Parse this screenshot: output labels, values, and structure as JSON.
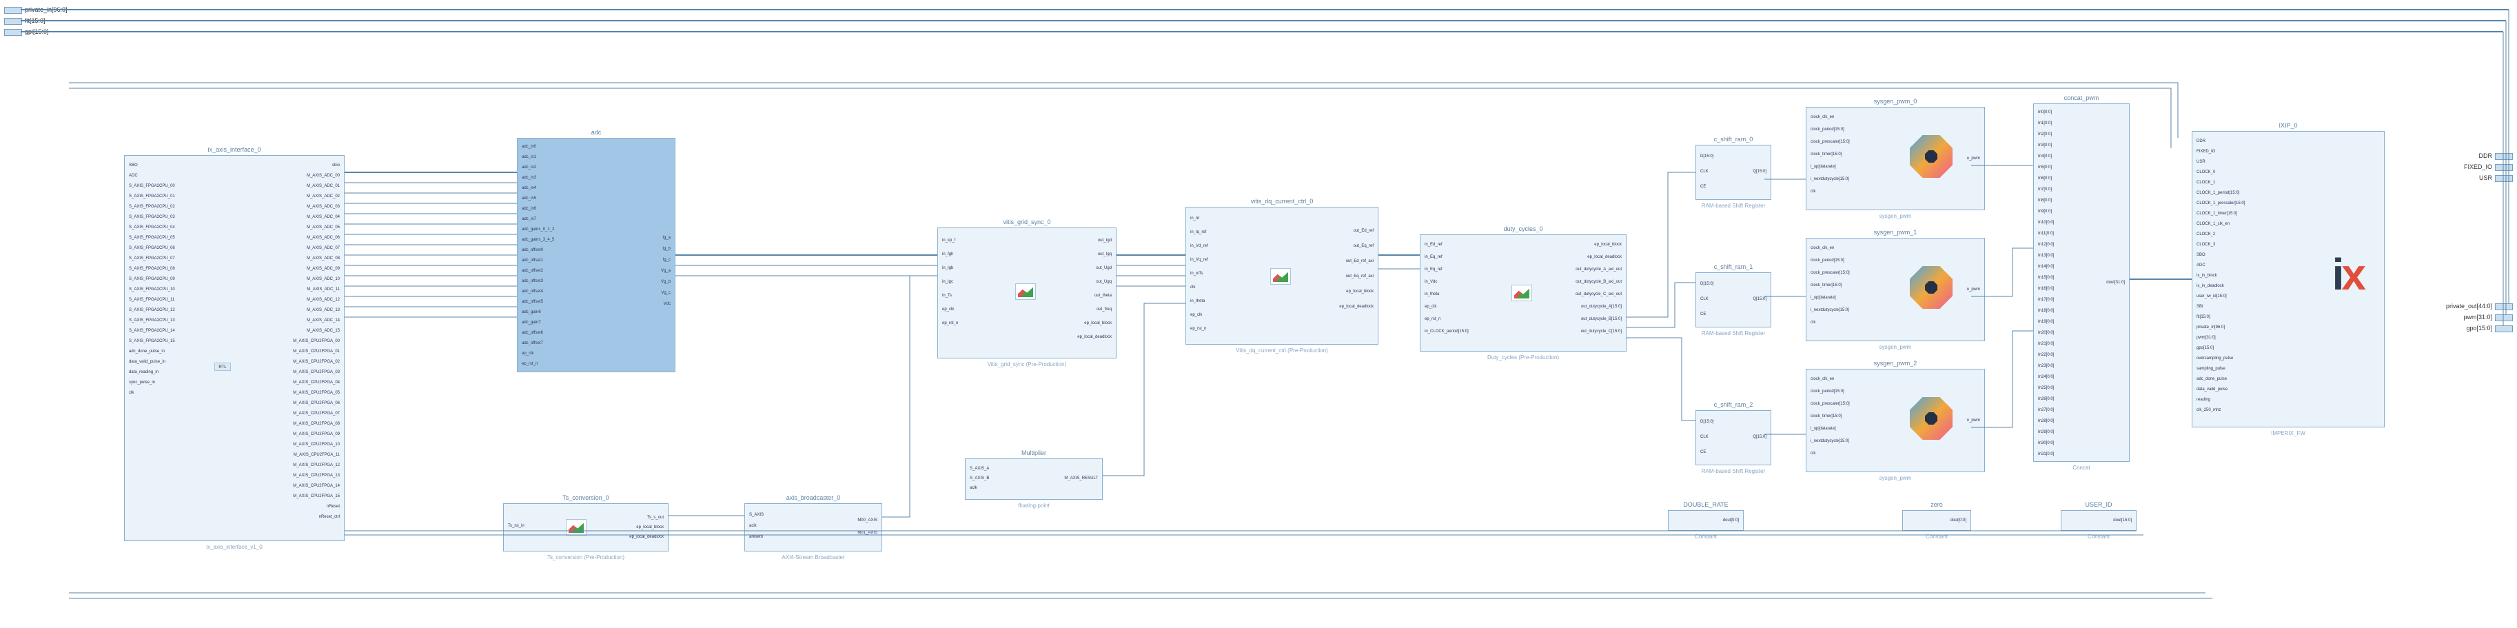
{
  "external_inputs": [
    {
      "label": "private_in[96:0]"
    },
    {
      "label": "fit[15:0]"
    },
    {
      "label": "gpi[15:0]"
    }
  ],
  "external_outputs_top": [
    {
      "label": "DDR"
    },
    {
      "label": "FIXED_IO"
    },
    {
      "label": "USR"
    }
  ],
  "external_outputs_mid": [
    {
      "label": "private_out[44:0]"
    },
    {
      "label": "pwm[31:0]"
    },
    {
      "label": "gpo[15:0]"
    }
  ],
  "ix_axis_interface": {
    "title": "ix_axis_interface_0",
    "subtitle": "ix_axis_interface_v1_0",
    "left_ports": [
      "SBO",
      "ADC",
      "S_AXIS_FPGA2CPU_00",
      "S_AXIS_FPGA2CPU_01",
      "S_AXIS_FPGA2CPU_02",
      "S_AXIS_FPGA2CPU_03",
      "S_AXIS_FPGA2CPU_04",
      "S_AXIS_FPGA2CPU_05",
      "S_AXIS_FPGA2CPU_06",
      "S_AXIS_FPGA2CPU_07",
      "S_AXIS_FPGA2CPU_08",
      "S_AXIS_FPGA2CPU_09",
      "S_AXIS_FPGA2CPU_10",
      "S_AXIS_FPGA2CPU_11",
      "S_AXIS_FPGA2CPU_12",
      "S_AXIS_FPGA2CPU_13",
      "S_AXIS_FPGA2CPU_14",
      "S_AXIS_FPGA2CPU_15",
      "adc_done_pulse_in",
      "data_valid_pulse_in",
      "data_reading_in",
      "sync_pulse_in",
      "clk"
    ],
    "right_ports": [
      "sbio",
      "M_AXIS_ADC_00",
      "M_AXIS_ADC_01",
      "M_AXIS_ADC_02",
      "M_AXIS_ADC_03",
      "M_AXIS_ADC_04",
      "M_AXIS_ADC_05",
      "M_AXIS_ADC_06",
      "M_AXIS_ADC_07",
      "M_AXIS_ADC_08",
      "M_AXIS_ADC_09",
      "M_AXIS_ADC_10",
      "M_AXIS_ADC_11",
      "M_AXIS_ADC_12",
      "M_AXIS_ADC_13",
      "M_AXIS_ADC_14",
      "M_AXIS_ADC_15",
      "M_AXIS_CPU2FPGA_00",
      "M_AXIS_CPU2FPGA_01",
      "M_AXIS_CPU2FPGA_02",
      "M_AXIS_CPU2FPGA_03",
      "M_AXIS_CPU2FPGA_04",
      "M_AXIS_CPU2FPGA_05",
      "M_AXIS_CPU2FPGA_06",
      "M_AXIS_CPU2FPGA_07",
      "M_AXIS_CPU2FPGA_08",
      "M_AXIS_CPU2FPGA_09",
      "M_AXIS_CPU2FPGA_10",
      "M_AXIS_CPU2FPGA_11",
      "M_AXIS_CPU2FPGA_12",
      "M_AXIS_CPU2FPGA_13",
      "M_AXIS_CPU2FPGA_14",
      "M_AXIS_CPU2FPGA_15",
      "nReset",
      "nReset_ctrl"
    ]
  },
  "adc": {
    "title": "adc",
    "left_ports": [
      "adc_in0",
      "adc_in1",
      "adc_in2",
      "adc_in3",
      "adc_in4",
      "adc_in5",
      "adc_in6",
      "adc_in7",
      "adc_gains_0_1_2",
      "adc_gains_3_4_5",
      "adc_offset0",
      "adc_offset1",
      "adc_offset2",
      "adc_offset3",
      "adc_offset4",
      "adc_offset5",
      "adc_gain6",
      "adc_gain7",
      "adc_offset6",
      "adc_offset7",
      "ep_clk",
      "ep_rst_n"
    ],
    "right_ports": [
      "Ig_a",
      "Ig_b",
      "Ig_c",
      "Vg_a",
      "Vg_b",
      "Vg_c",
      "Vdc"
    ]
  },
  "ts_conversion": {
    "title": "Ts_conversion_0",
    "subtitle": "Ts_conversion (Pre-Production)",
    "left_ports": [
      "Ts_ns_in"
    ],
    "right_ports": [
      "Ts_s_out",
      "ep_local_block",
      "ep_local_deadlock"
    ]
  },
  "axis_broadcaster": {
    "title": "axis_broadcaster_0",
    "subtitle": "AXI4-Stream Broadcaster",
    "left_ports": [
      "S_AXIS",
      "aclk",
      "aresetn"
    ],
    "right_ports": [
      "M00_AXIS",
      "M01_AXIS"
    ]
  },
  "vitis_grid_sync": {
    "title": "vitis_grid_sync_0",
    "subtitle": "Vitis_grid_sync (Pre-Production)",
    "left_ports": [
      "in_kp_f",
      "in_fgh",
      "in_Igb",
      "in_Igc",
      "in_Ts",
      "ep_clk",
      "ep_rst_n"
    ],
    "right_ports": [
      "out_Igd",
      "out_Igq",
      "out_Ugd",
      "out_Ugq",
      "out_theta",
      "out_freq",
      "ep_local_block",
      "ep_local_deadlock"
    ]
  },
  "multiplier": {
    "title": "Multiplier",
    "subtitle": "floating-point",
    "left_ports": [
      "S_AXIS_A",
      "S_AXIS_B",
      "aclk"
    ],
    "right_ports": [
      "M_AXIS_RESULT"
    ]
  },
  "vitis_dq_current": {
    "title": "vitis_dq_current_ctrl_0",
    "subtitle": "Vitis_dq_current_ctrl (Pre-Production)",
    "left_ports": [
      "in_Id",
      "in_Iq_ref",
      "in_Vd_ref",
      "in_Vq_ref",
      "in_wTs",
      "clk",
      "in_theta",
      "ep_clk",
      "ep_rst_n"
    ],
    "right_ports": [
      "out_Ed_ref",
      "out_Eq_ref",
      "out_Ed_ref_axi",
      "out_Eq_ref_axi",
      "ep_local_block",
      "ep_local_deadlock"
    ]
  },
  "duty_cycles": {
    "title": "duty_cycles_0",
    "subtitle": "Duty_cycles (Pre-Production)",
    "left_ports": [
      "in_Ed_ref",
      "in_Eq_ref",
      "in_Eq_ref",
      "in_Vdc",
      "in_theta",
      "ep_clk",
      "ep_rst_n",
      "in_CLOCK_period[15:0]"
    ],
    "right_ports": [
      "ep_local_block",
      "ep_local_deadlock",
      "out_dutycycle_A_axi_out",
      "out_dutycycle_B_axi_out",
      "out_dutycycle_C_axi_out",
      "out_dutycycle_A[15:0]",
      "out_dutycycle_B[15:0]",
      "out_dutycycle_C[15:0]"
    ]
  },
  "shift_ram": {
    "subtitle": "RAM-based Shift Register",
    "items": [
      "c_shift_ram_0",
      "c_shift_ram_1",
      "c_shift_ram_2"
    ],
    "left_ports": [
      "D[15:0]",
      "CLK",
      "CE"
    ],
    "right_ports": [
      "Q[15:0]"
    ]
  },
  "sysgen_pwm": {
    "subtitle": "sysgen_pwm",
    "items": [
      "sysgen_pwm_0",
      "sysgen_pwm_1",
      "sysgen_pwm_2"
    ],
    "left_ports": [
      "clock_clk_en",
      "clock_period[15:0]",
      "clock_prescaler[15:0]",
      "clock_timer[15:0]",
      "i_up[datarate]",
      "i_nextdutycycle[15:0]",
      "clk"
    ],
    "right_ports": [
      "o_pwm"
    ]
  },
  "concat_pwm": {
    "title": "concat_pwm",
    "subtitle": "Concat",
    "left_ports": [
      "In0[0:0]",
      "In1[0:0]",
      "In2[0:0]",
      "In3[0:0]",
      "In4[0:0]",
      "In5[0:0]",
      "In6[0:0]",
      "In7[0:0]",
      "In8[0:0]",
      "In9[0:0]",
      "In10[0:0]",
      "In11[0:0]",
      "In12[0:0]",
      "In13[0:0]",
      "In14[0:0]",
      "In15[0:0]",
      "In16[0:0]",
      "In17[0:0]",
      "In18[0:0]",
      "In19[0:0]",
      "In20[0:0]",
      "In21[0:0]",
      "In22[0:0]",
      "In23[0:0]",
      "In24[0:0]",
      "In25[0:0]",
      "In26[0:0]",
      "In27[0:0]",
      "In28[0:0]",
      "In29[0:0]",
      "In30[0:0]",
      "In31[0:0]"
    ],
    "right_ports": [
      "dout[31:0]"
    ]
  },
  "ixip": {
    "title": "IXIP_0",
    "subtitle": "IMPERIX_FW",
    "left_ports": [
      "DDR",
      "FIXED_IO",
      "USR",
      "CLOCK_0",
      "CLOCK_1",
      "CLOCK_1_period[15:0]",
      "CLOCK_1_prescaler[15:0]",
      "CLOCK_1_timer[15:0]",
      "CLOCK_1_clk_en",
      "CLOCK_2",
      "CLOCK_3",
      "SBO",
      "ADC",
      "ix_in_block",
      "ix_in_deadlock",
      "user_iw_id[15:0]",
      "SBI",
      "fit[15:0]",
      "private_in[96:0]",
      "pwm[31:0]",
      "gpo[15:0]",
      "oversampling_pulse",
      "sampling_pulse",
      "adc_done_pulse",
      "data_valid_pulse",
      "reading",
      "clk_250_mhz"
    ],
    "right_ports": []
  },
  "double_rate": {
    "title": "DOUBLE_RATE",
    "subtitle": "Constant",
    "out": "dout[0:0]"
  },
  "zero": {
    "title": "zero",
    "subtitle": "Constant",
    "out": "dout[0:0]"
  },
  "user_id": {
    "title": "USER_ID",
    "subtitle": "Constant",
    "out": "dout[15:0]"
  }
}
